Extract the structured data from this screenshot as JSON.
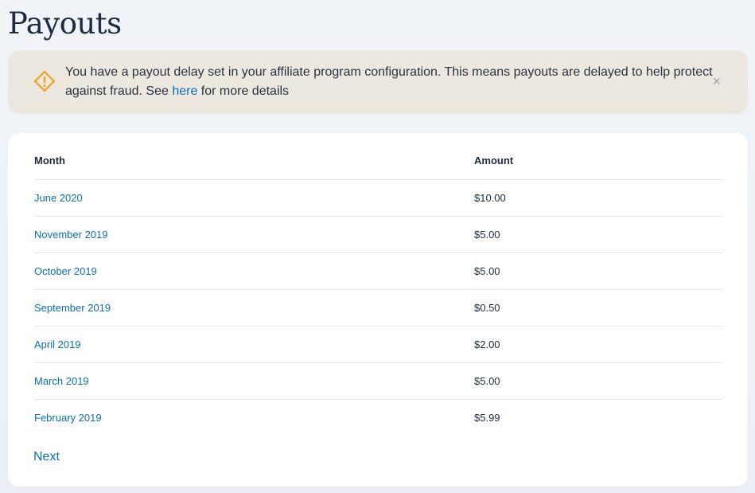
{
  "page": {
    "title": "Payouts"
  },
  "alert": {
    "icon": "warning-diamond-icon",
    "text_before": "You have a payout delay set in your affiliate program configuration. This means payouts are delayed to help protect against fraud. See ",
    "link_label": "here",
    "text_after": " for more details",
    "close_label": "×"
  },
  "table": {
    "headers": {
      "month": "Month",
      "amount": "Amount"
    },
    "rows": [
      {
        "month": "June 2020",
        "amount": "$10.00"
      },
      {
        "month": "November 2019",
        "amount": "$5.00"
      },
      {
        "month": "October 2019",
        "amount": "$5.00"
      },
      {
        "month": "September 2019",
        "amount": "$0.50"
      },
      {
        "month": "April 2019",
        "amount": "$2.00"
      },
      {
        "month": "March 2019",
        "amount": "$5.00"
      },
      {
        "month": "February 2019",
        "amount": "$5.99"
      }
    ]
  },
  "pagination": {
    "next_label": "Next"
  },
  "colors": {
    "link": "#0a6fb5",
    "warning": "#f0a020",
    "alert_bg": "#ece8df"
  }
}
